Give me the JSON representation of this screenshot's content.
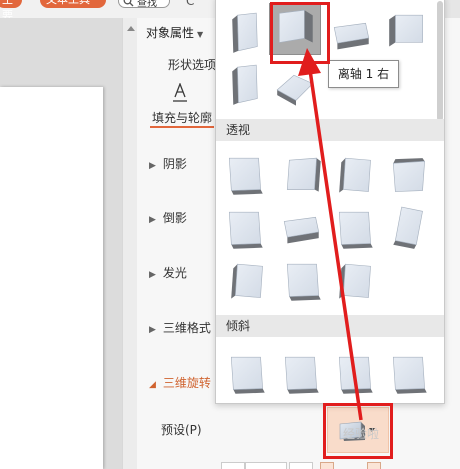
{
  "topbar": {
    "pill_left": "王要",
    "pill_mid": "文本工具",
    "search_text": "查找",
    "right_letter": "C"
  },
  "pane": {
    "title": "对象属性",
    "tab": "形状选项",
    "fill_label": "填充与轮廓",
    "sections": [
      "阴影",
      "倒影",
      "发光",
      "三维格式",
      "三维旋转"
    ],
    "active_section": "三维旋转",
    "preset_label": "预设(P)"
  },
  "dropdown": {
    "categories": [
      "透视",
      "倾斜"
    ],
    "tooltip": "离轴 1 右"
  },
  "watermark": "经验啦",
  "colors": {
    "accent": "#d0632f",
    "tile_face": "#d3dbe6",
    "annotation_red": "#e11d1d",
    "selected_bg": "#ababab"
  },
  "icons": {
    "search": "search-icon",
    "fill": "fill-line-icon",
    "section_collapsed": "triangle-right-icon",
    "section_expanded": "triangle-down-icon"
  }
}
